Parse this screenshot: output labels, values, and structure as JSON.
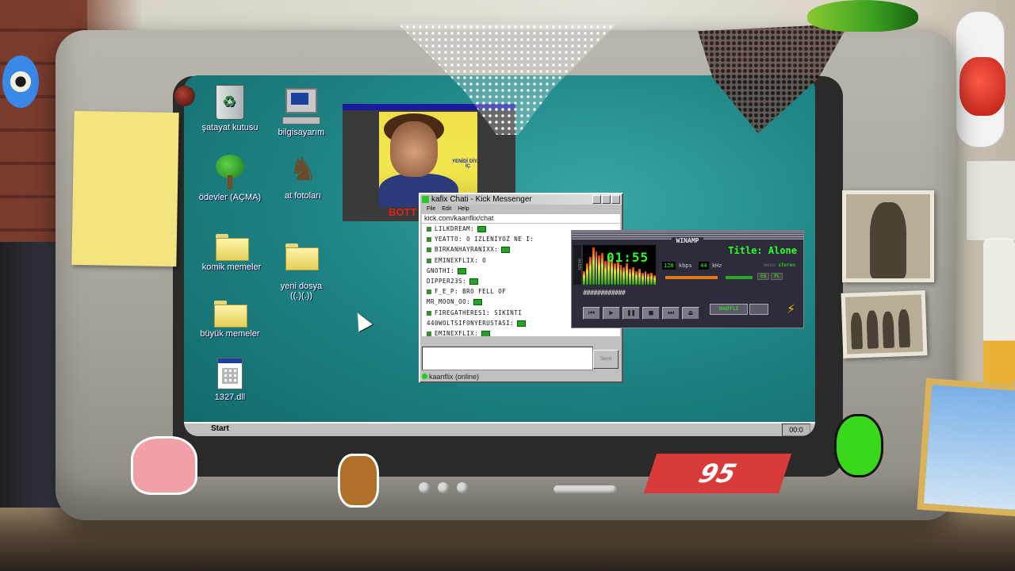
{
  "desktop": {
    "icons": [
      {
        "label": "şatayat kutusu",
        "icon": "recycle-bin-icon"
      },
      {
        "label": "bilgisayarım",
        "icon": "computer-icon"
      },
      {
        "label": "ödevler (AÇMA)",
        "icon": "tree-icon"
      },
      {
        "label": "at fotoları",
        "icon": "horse-icon"
      },
      {
        "label": "komik memeler",
        "icon": "folder-icon"
      },
      {
        "label": "yeni dosya\n((.)(.))",
        "icon": "folder-icon"
      },
      {
        "label": "büyük memeler",
        "icon": "folder-icon"
      },
      {
        "label": "1327.dll",
        "icon": "dll-file-icon"
      }
    ]
  },
  "video_window": {
    "label": "BOTT",
    "caption": "YENİDİ DİYAR İÇ"
  },
  "messenger": {
    "title": "kafix Chati - Kick Messenger",
    "menu": [
      "File",
      "Edit",
      "Help"
    ],
    "url": "kick.com/kaanflix/chat",
    "messages": [
      "LILKDREAM:",
      "YEATTO: O IZLENIYOZ NE I:",
      "BIRKANHAYRANIXX:",
      "EMINEXFLIX: O",
      "GNOTHI:",
      "DIPPER23S:",
      "F_E_P: BRO FELL OF",
      "MR_MOON_OO:",
      "FIREGATHERES1: SIKINTI",
      "440WOLTSIFONYERUSTASI:",
      "EMINEXFLIX:"
    ],
    "input_value": "",
    "send_label": "Send",
    "status": "kaanflix (online)"
  },
  "winamp": {
    "title": "WINAMP",
    "time": "01:55",
    "song_title": "Title: Alone",
    "kbps": "128",
    "kbps_label": "kbps",
    "khz": "44",
    "khz_label": "kHz",
    "mono": "mono",
    "stereo": "stereo",
    "eq_label": "EQ",
    "pl_label": "PL",
    "position_bar": "############",
    "shuffle_label": "SHUFFLE",
    "sidebar_text": "OAIDV",
    "spectrum": [
      0.35,
      0.55,
      0.7,
      0.95,
      0.85,
      0.75,
      0.8,
      0.6,
      0.7,
      0.65,
      0.55,
      0.6,
      0.5,
      0.45,
      0.55,
      0.4,
      0.45,
      0.35,
      0.4,
      0.3,
      0.35,
      0.28,
      0.3,
      0.25
    ]
  },
  "taskbar": {
    "start_label": "Start",
    "clock": "00:0"
  },
  "decor": {
    "sticker_95": "95"
  },
  "colors": {
    "desktop_bg": "#1f8585",
    "winamp_green": "#28ff28",
    "kick_green": "#28c828"
  }
}
